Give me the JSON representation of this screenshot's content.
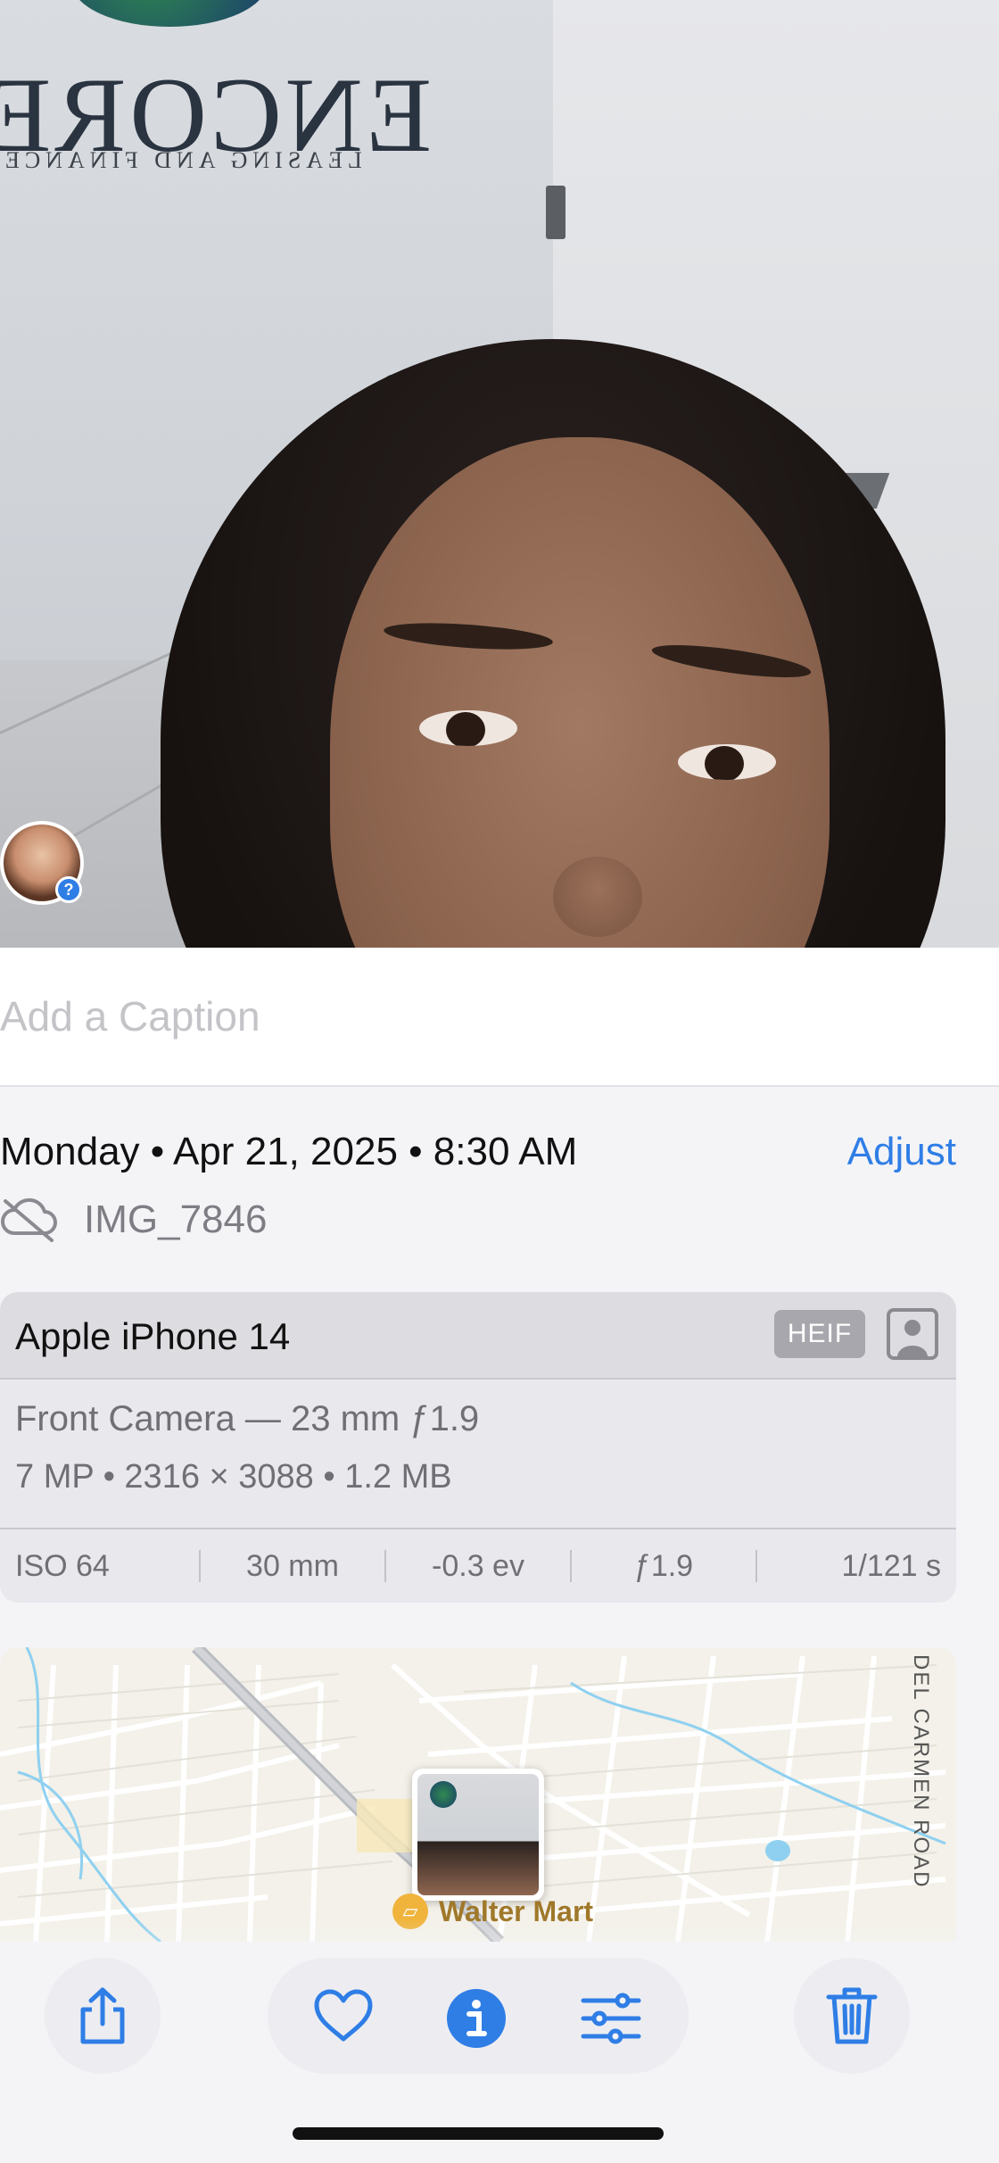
{
  "photo": {
    "logo_text": "ENCORE",
    "logo_subtext": "LEASING AND FINANCE"
  },
  "caption": {
    "placeholder": "Add a Caption"
  },
  "info": {
    "datetime": "Monday • Apr 21, 2025 • 8:30 AM",
    "adjust_label": "Adjust",
    "filename": "IMG_7846"
  },
  "camera_card": {
    "device": "Apple iPhone 14",
    "format_badge": "HEIF",
    "lens": "Front Camera — 23 mm ƒ1.9",
    "specs": "7 MP  •  2316 × 3088  •  1.2 MB",
    "exif": {
      "iso": "ISO 64",
      "focal": "30 mm",
      "ev": "-0.3 ev",
      "aperture": "ƒ1.9",
      "shutter": "1/121 s"
    }
  },
  "map": {
    "road_label": "DEL CARMEN ROAD",
    "poi_label": "Walter Mart"
  },
  "toolbar": {
    "icons": [
      "share-icon",
      "heart-icon",
      "info-icon",
      "adjustments-icon",
      "trash-icon"
    ],
    "accent": "#2f7ee6"
  },
  "colors": {
    "accent": "#2f7ee6",
    "text": "#111111",
    "secondary": "#7d7d83"
  }
}
